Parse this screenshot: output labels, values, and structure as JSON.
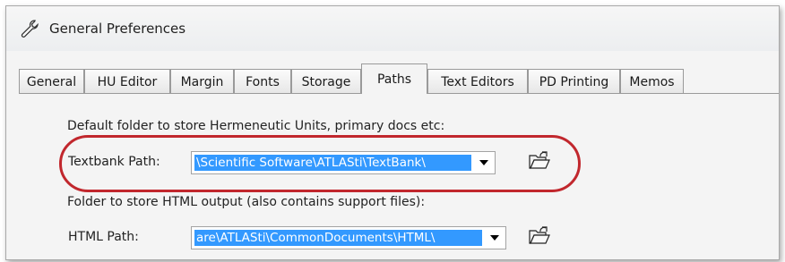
{
  "window": {
    "title": "General Preferences",
    "icon": "wrench-icon"
  },
  "tabs": [
    {
      "label": "General",
      "active": false
    },
    {
      "label": "HU Editor",
      "active": false
    },
    {
      "label": "Margin",
      "active": false
    },
    {
      "label": "Fonts",
      "active": false
    },
    {
      "label": "Storage",
      "active": false
    },
    {
      "label": "Paths",
      "active": true
    },
    {
      "label": "Text Editors",
      "active": false
    },
    {
      "label": "PD Printing",
      "active": false
    },
    {
      "label": "Memos",
      "active": false
    }
  ],
  "paths": {
    "textbank_description": "Default folder to store Hermeneutic Units, primary docs etc:",
    "textbank_label": "Textbank Path:",
    "textbank_value": "\\Scientific Software\\ATLASti\\TextBank\\",
    "html_description": "Folder to store HTML output (also contains support files):",
    "html_label": "HTML Path:",
    "html_value": "are\\ATLASti\\CommonDocuments\\HTML\\",
    "dropdown_icon": "chevron-down-icon",
    "browse_icon": "open-folder-icon"
  },
  "colors": {
    "highlight": "#3399ff",
    "annotation": "#c1272d"
  }
}
